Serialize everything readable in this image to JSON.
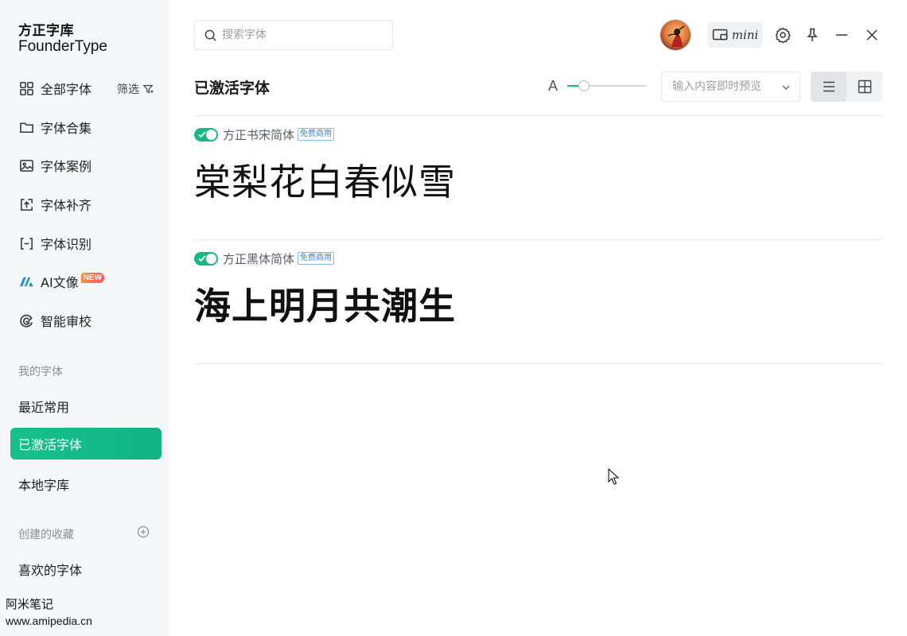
{
  "app": {
    "logo_cn": "方正字库",
    "logo_en": "FounderType"
  },
  "sidebar": {
    "filter_label": "筛选",
    "new_badge": "NEW",
    "items": [
      {
        "label": "全部字体",
        "icon": "grid-icon"
      },
      {
        "label": "字体合集",
        "icon": "folder-icon"
      },
      {
        "label": "字体案例",
        "icon": "image-icon"
      },
      {
        "label": "字体补齐",
        "icon": "upload-box-icon"
      },
      {
        "label": "字体识别",
        "icon": "scan-icon"
      },
      {
        "label": "AI文像",
        "icon": "ai-logo-icon"
      },
      {
        "label": "智能审校",
        "icon": "proofread-icon"
      }
    ],
    "my_fonts_label": "我的字体",
    "my_fonts": [
      {
        "label": "最近常用"
      },
      {
        "label": "已激活字体"
      },
      {
        "label": "本地字库"
      }
    ],
    "collections_label": "创建的收藏",
    "collections": [
      {
        "label": "喜欢的字体"
      }
    ],
    "watermark_line1": "阿米笔记",
    "watermark_line2": "www.amipedia.cn"
  },
  "header": {
    "search_placeholder": "搜索字体",
    "mini_label": "mini"
  },
  "toolbar": {
    "title": "已激活字体",
    "size_icon_label": "A",
    "size_level": 0.15,
    "preview_placeholder": "输入内容即时预览"
  },
  "fonts": [
    {
      "name": "方正书宋简体",
      "tag": "免费商用",
      "sample": "棠梨花白春似雪",
      "enabled": true
    },
    {
      "name": "方正黑体简体",
      "tag": "免费商用",
      "sample": "海上明月共潮生",
      "enabled": true
    }
  ],
  "colors": {
    "accent": "#17b886",
    "sidebar_bg": "#f5f6f7",
    "tag_blue": "#3c86d6"
  }
}
